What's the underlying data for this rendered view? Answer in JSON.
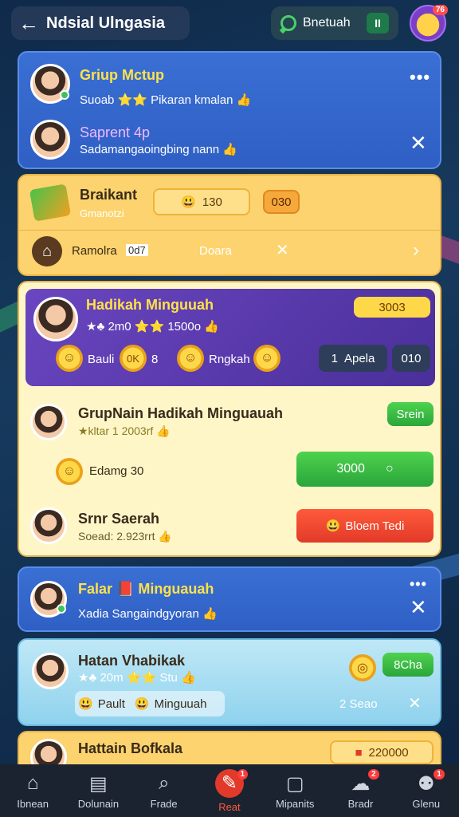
{
  "header": {
    "title": "Ndsial Ulngasia",
    "status_label": "Bnetuah",
    "pause_glyph": "II",
    "profile_badge": "76"
  },
  "card1": {
    "row1": {
      "title": "Griup Mctup",
      "sub": "Suoab ⭐⭐ Pikaran kmalan 👍"
    },
    "row2": {
      "title": "Saprent 4p",
      "sub": "Sadamangaoingbing nann 👍"
    }
  },
  "card2": {
    "title": "Braikant",
    "sub": "Gmanotzi",
    "score": "130",
    "score_badge": "030",
    "row_label": "Ramolra",
    "row_tag": "0d7",
    "row_mid": "Doara"
  },
  "card3": {
    "banner": {
      "title": "Hadikah Minguuah",
      "sub": "★♣ 2m0 ⭐⭐ 1500o 👍",
      "score_badge": "3003",
      "left_label": "Bauli",
      "left_badge": "0K",
      "left_extra": "8",
      "mid_label": "Rngkah",
      "apela_label": "Apela",
      "apela_num": "1",
      "right_badge": "010"
    },
    "row1": {
      "title": "GrupNain Hadikah Minguauah",
      "sub": "★kltar 1 2003rf 👍",
      "button": "Srein"
    },
    "row2": {
      "label": "Edamg 30",
      "button": "3000"
    },
    "row3": {
      "title": "Srnr Saerah",
      "sub": "Soead: 2.923rrt 👍",
      "button": "Bloem Tedi"
    }
  },
  "card4": {
    "title": "Falar 📕 Minguauah",
    "sub": "Xadia Sangaindgyoran 👍"
  },
  "card5": {
    "title": "Hatan Vhabikak",
    "sub": "★♣ 20m ⭐⭐ Stu 👍",
    "badge": "8Cha",
    "chip1": "Pault",
    "chip2": "Minguuah",
    "right_text": "2 Seao"
  },
  "card6": {
    "title": "Hattain Bofkala",
    "score": "220000"
  },
  "nav": [
    {
      "label": "Ibnean",
      "glyph": "⌂",
      "icon": "home-icon"
    },
    {
      "label": "Dolunain",
      "glyph": "▤",
      "icon": "document-icon"
    },
    {
      "label": "Frade",
      "glyph": "⌕",
      "icon": "search-icon"
    },
    {
      "label": "Reat",
      "glyph": "✎",
      "icon": "pen-icon",
      "badge": "1"
    },
    {
      "label": "Mipanits",
      "glyph": "▢",
      "icon": "square-icon"
    },
    {
      "label": "Bradr",
      "glyph": "☁",
      "icon": "cloud-icon",
      "badge": "2"
    },
    {
      "label": "Glenu",
      "glyph": "⚉",
      "icon": "menu-icon",
      "badge": "1"
    }
  ],
  "colors": {
    "accent_blue": "#3a6fd4",
    "accent_yellow": "#fcd36e",
    "accent_purple": "#6a46c0",
    "green": "#2aa63a",
    "red": "#e23a2a"
  }
}
